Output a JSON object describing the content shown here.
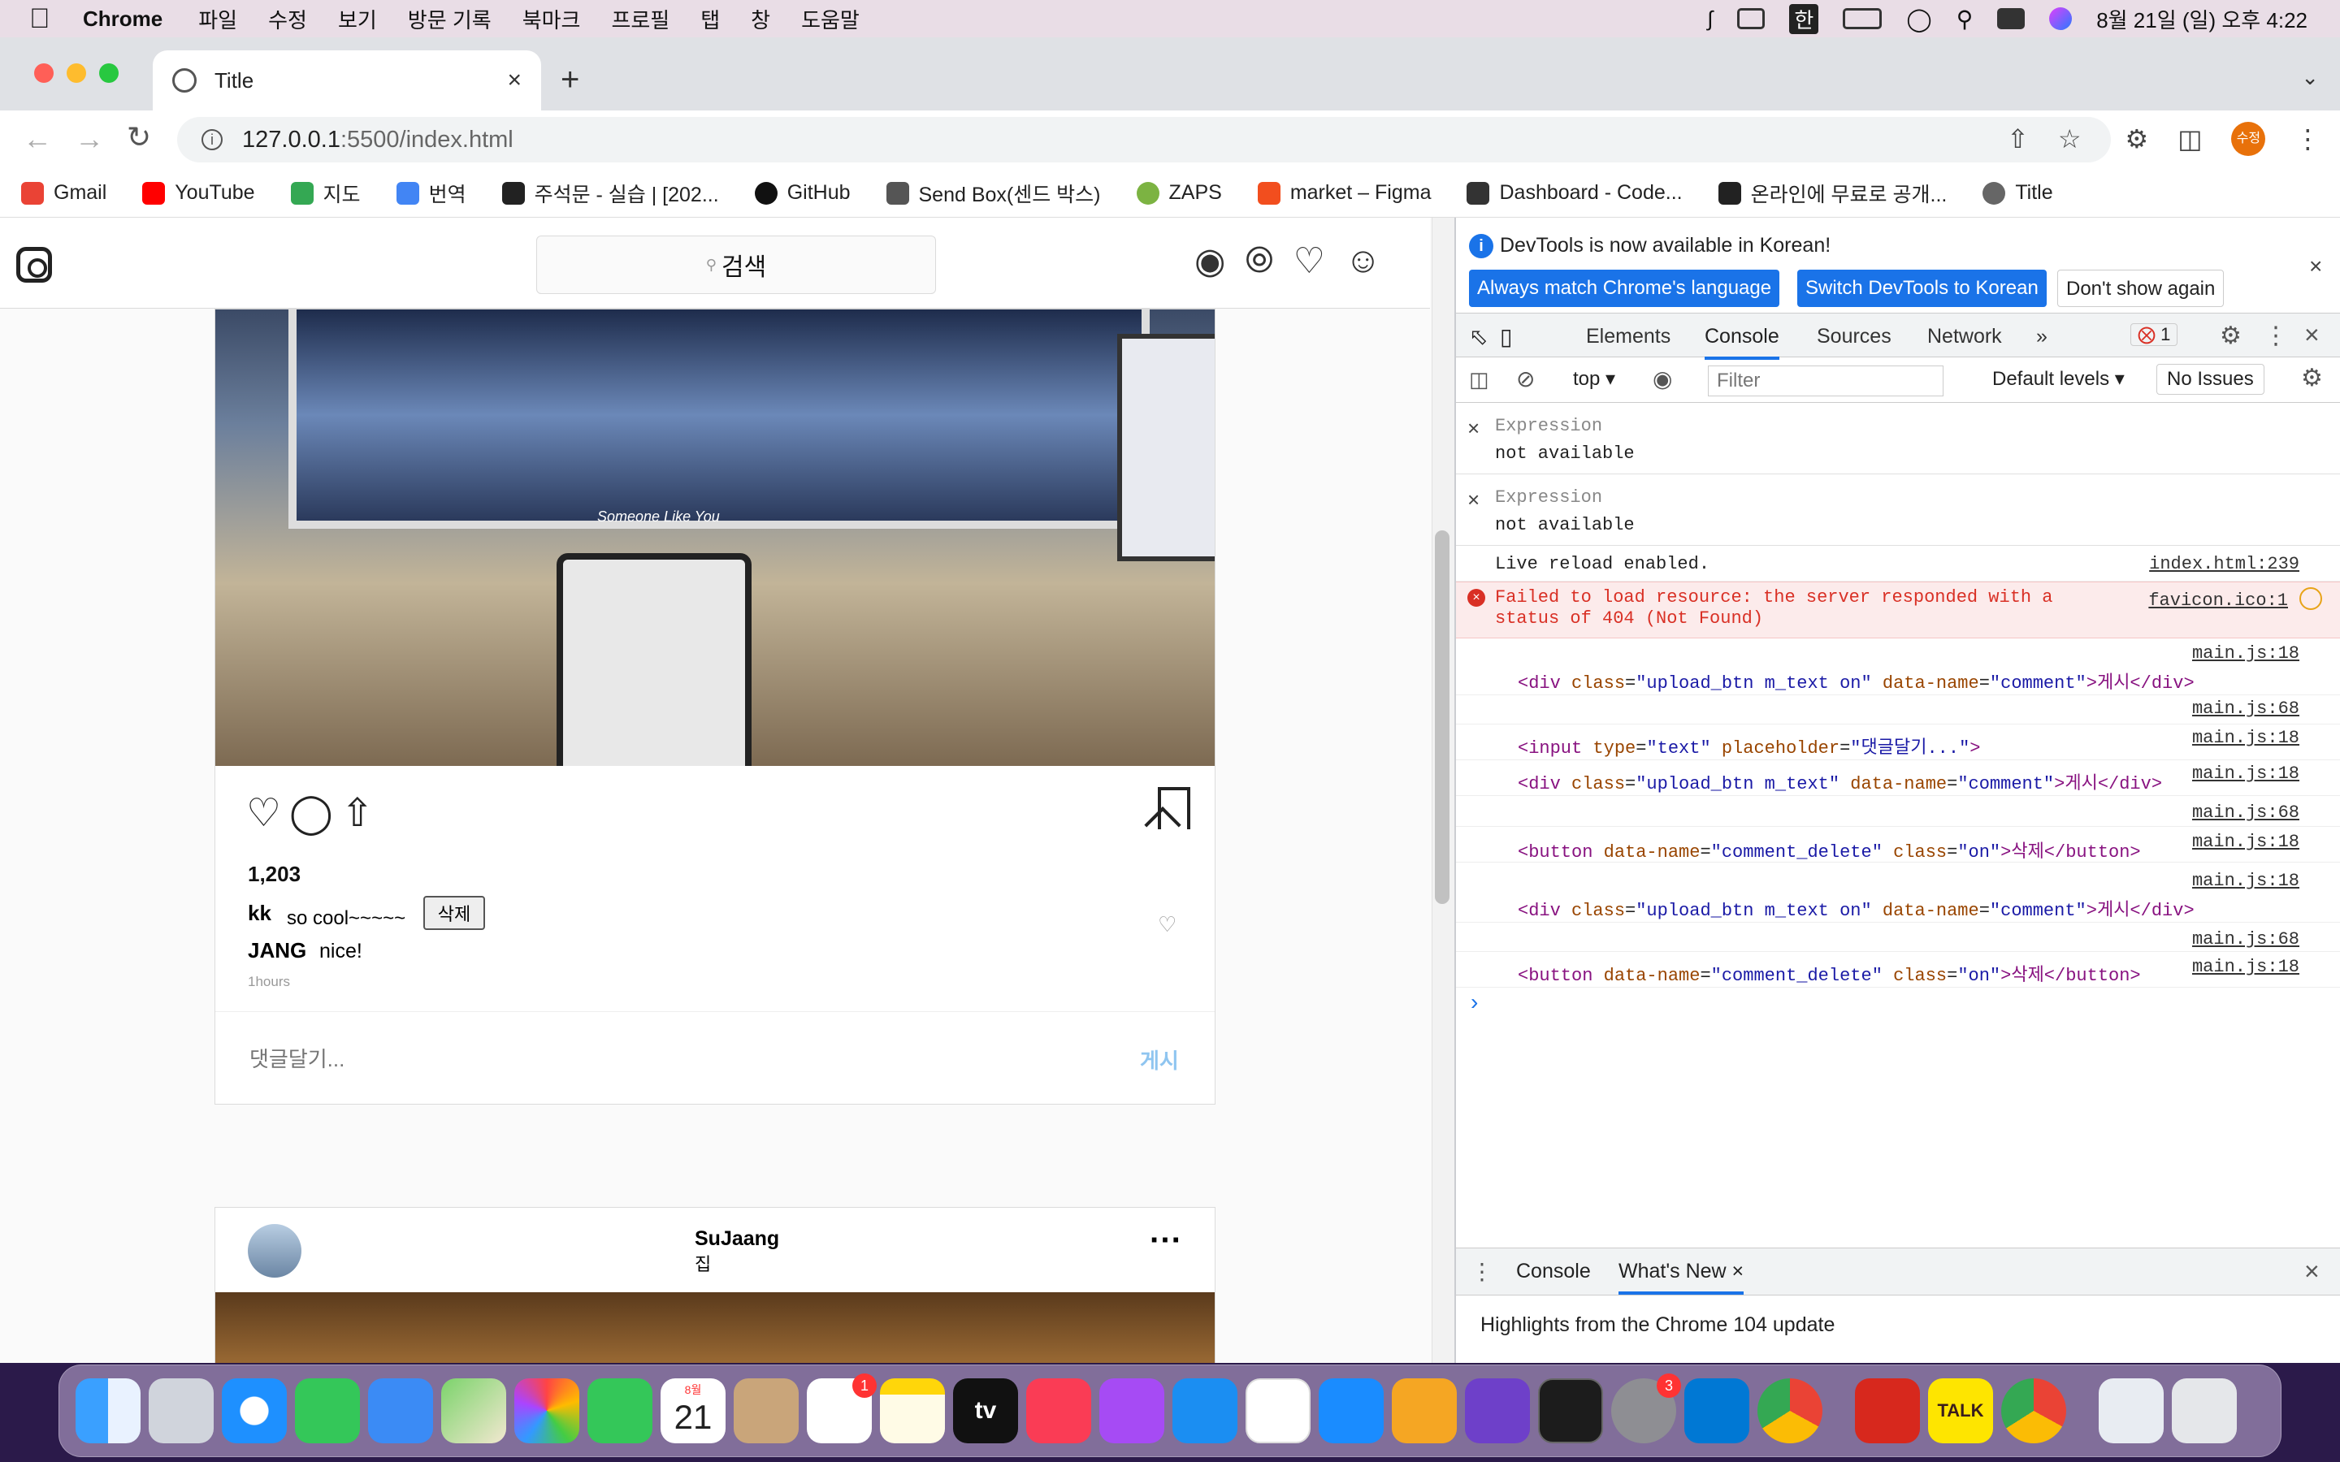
{
  "menubar": {
    "app": "Chrome",
    "items": [
      "파일",
      "수정",
      "보기",
      "방문 기록",
      "북마크",
      "프로필",
      "탭",
      "창",
      "도움말"
    ],
    "ime": "한",
    "clock": "8월 21일 (일) 오후 4:22"
  },
  "browser": {
    "tab_title": "Title",
    "url_host": "127.0.0.1",
    "url_path": ":5500/index.html",
    "profile_label": "수정",
    "bookmarks": [
      {
        "label": "Gmail",
        "color": "#ea4335"
      },
      {
        "label": "YouTube",
        "color": "#ff0000"
      },
      {
        "label": "지도",
        "color": "#34a853"
      },
      {
        "label": "번역",
        "color": "#4285f4"
      },
      {
        "label": "주석문 - 실습 | [202...",
        "color": "#222222"
      },
      {
        "label": "GitHub",
        "color": "#111111"
      },
      {
        "label": "Send Box(센드 박스)",
        "color": "#555555"
      },
      {
        "label": "ZAPS",
        "color": "#7cb342"
      },
      {
        "label": "market – Figma",
        "color": "#f24e1e"
      },
      {
        "label": "Dashboard - Code...",
        "color": "#333333"
      },
      {
        "label": "온라인에 무료로 공개...",
        "color": "#222222"
      },
      {
        "label": "Title",
        "color": "#666666"
      }
    ]
  },
  "page": {
    "search_label": "검색",
    "post1": {
      "photo_caption": "Someone Like You",
      "likes": "1,203",
      "comments": [
        {
          "user": "kk",
          "text": "so cool~~~~~",
          "delete_label": "삭제"
        },
        {
          "user": "JANG",
          "text": "nice!"
        }
      ],
      "time": "1hours",
      "comment_placeholder": "댓글달기...",
      "post_label": "게시"
    },
    "post2": {
      "user": "SuJaang",
      "location": "집",
      "more": "···"
    }
  },
  "devtools": {
    "banner_msg": "DevTools is now available in Korean!",
    "banner_btn1": "Always match Chrome's language",
    "banner_btn2": "Switch DevTools to Korean",
    "banner_btn3": "Don't show again",
    "tabs": [
      "Elements",
      "Console",
      "Sources",
      "Network"
    ],
    "error_count": "1",
    "context": "top",
    "filter_placeholder": "Filter",
    "levels": "Default levels",
    "issues": "No Issues",
    "expressions": [
      {
        "label": "Expression",
        "value": "not available"
      },
      {
        "label": "Expression",
        "value": "not available"
      }
    ],
    "live_reload": "Live reload enabled.",
    "live_reload_src": "index.html:239",
    "error_text_1": "Failed to load resource: the server responded with a",
    "error_text_2": "status of 404 (Not Found)",
    "error_src": "favicon.ico:1",
    "logs": [
      {
        "src_top": "main.js:18",
        "html": "div-on",
        "src": ""
      },
      {
        "src_top": "main.js:68",
        "html": "",
        "src": ""
      },
      {
        "src_top": "",
        "html": "input",
        "src": "main.js:18"
      },
      {
        "src_top": "",
        "html": "div",
        "src": "main.js:18"
      },
      {
        "src_top": "main.js:68",
        "html": "",
        "src": ""
      },
      {
        "src_top": "",
        "html": "button",
        "src": "main.js:18"
      },
      {
        "src_top": "main.js:18",
        "html": "div-on",
        "src": ""
      },
      {
        "src_top": "main.js:68",
        "html": "",
        "src": ""
      },
      {
        "src_top": "",
        "html": "button",
        "src": "main.js:18"
      }
    ],
    "code": {
      "div_on_open": "<div ",
      "class_attr": "class",
      "div_on_class": "\"upload_btn m_text on\"",
      "div_class": "\"upload_btn m_text\"",
      "dataname_attr": "data-name",
      "comment_val": "\"comment\"",
      "div_text": ">게시</div>",
      "input_open": "<input ",
      "type_attr": "type",
      "type_val": "\"text\"",
      "placeholder_attr": "placeholder",
      "placeholder_val": "\"댓글달기...\"",
      "input_close": ">",
      "button_open": "<button ",
      "delete_val": "\"comment_delete\"",
      "on_val": "\"on\"",
      "button_text": ">삭제</button>"
    },
    "drawer_tabs": [
      "Console",
      "What's New"
    ],
    "drawer_text": "Highlights from the Chrome 104 update"
  },
  "dock": {
    "calendar_month": "8월",
    "calendar_day": "21",
    "reminders_badge": "1",
    "settings_badge": "3",
    "kakaotalk_label": "TALK",
    "appletv_label": "tv"
  },
  "colors": {
    "chrome_blue": "#1a73e8",
    "ig_link": "#8fc5f0",
    "error_red": "#d93025"
  }
}
